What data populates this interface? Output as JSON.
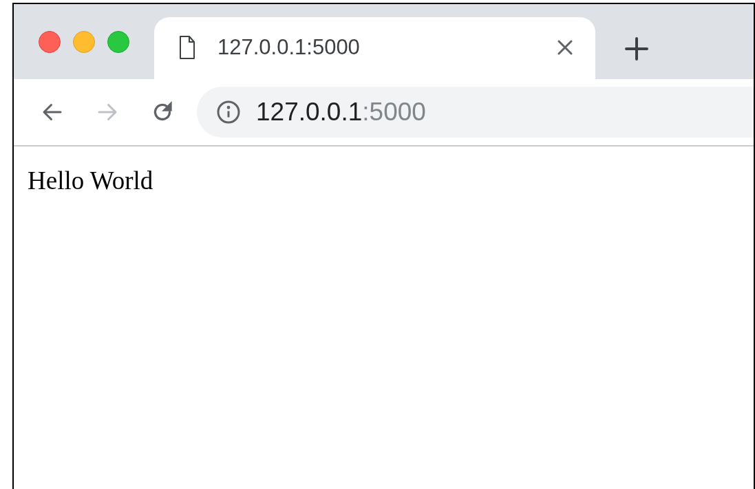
{
  "tabs": [
    {
      "title": "127.0.0.1:5000",
      "selected": true
    }
  ],
  "toolbar": {
    "back": {
      "disabled": false
    },
    "forward": {
      "disabled": true
    }
  },
  "address_bar": {
    "host": "127.0.0.1",
    "port": ":5000"
  },
  "page": {
    "text": "Hello World"
  }
}
